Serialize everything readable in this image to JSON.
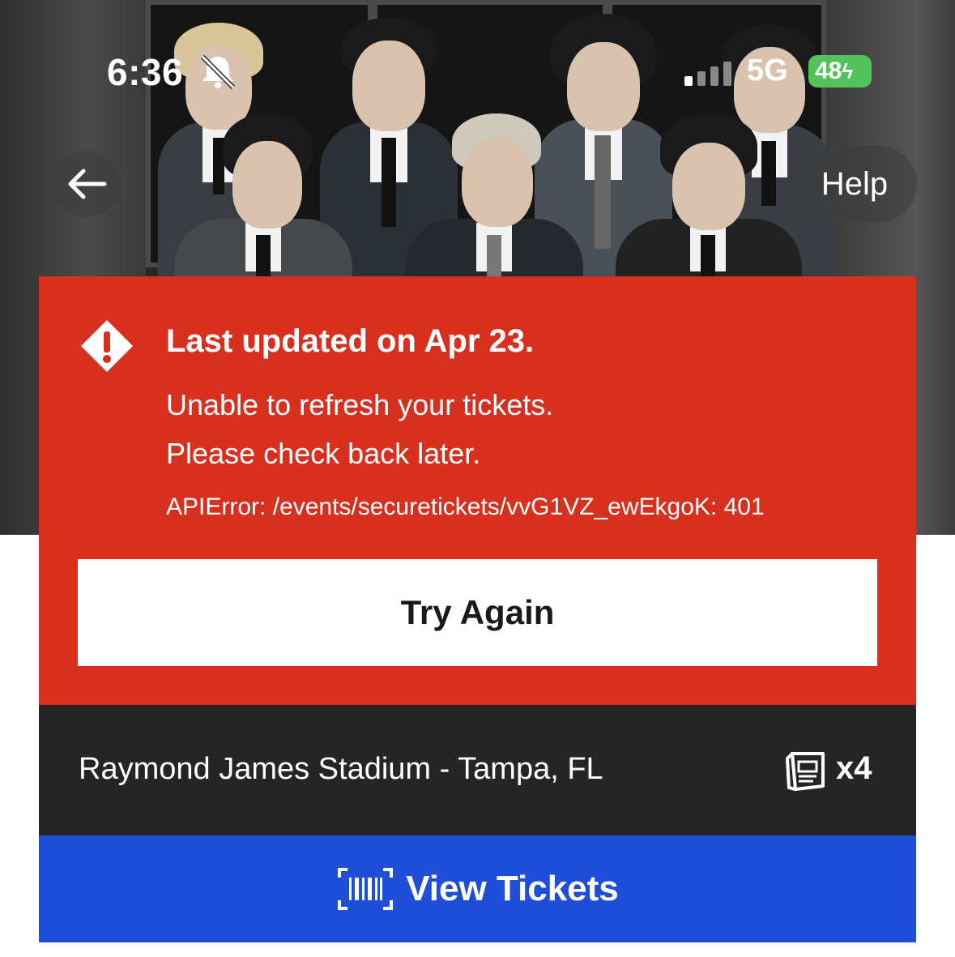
{
  "status_bar": {
    "time": "6:36",
    "network": "5G",
    "battery": "48"
  },
  "nav": {
    "back_icon": "arrow-left-icon",
    "help_label": "Help"
  },
  "error": {
    "icon": "warning-diamond-icon",
    "title": "Last updated on Apr 23.",
    "message_line1": "Unable to refresh your tickets.",
    "message_line2": "Please check back later.",
    "code": "APIError: /events/securetickets/vvG1VZ_ewEkgoK: 401",
    "retry_label": "Try Again",
    "color": "#d8301f"
  },
  "venue": {
    "name": "Raymond James Stadium - Tampa, FL",
    "ticket_icon": "tickets-icon",
    "ticket_count": "x4"
  },
  "actions": {
    "view_tickets_icon": "barcode-scan-icon",
    "view_tickets_label": "View Tickets",
    "color": "#1f4fd8"
  }
}
